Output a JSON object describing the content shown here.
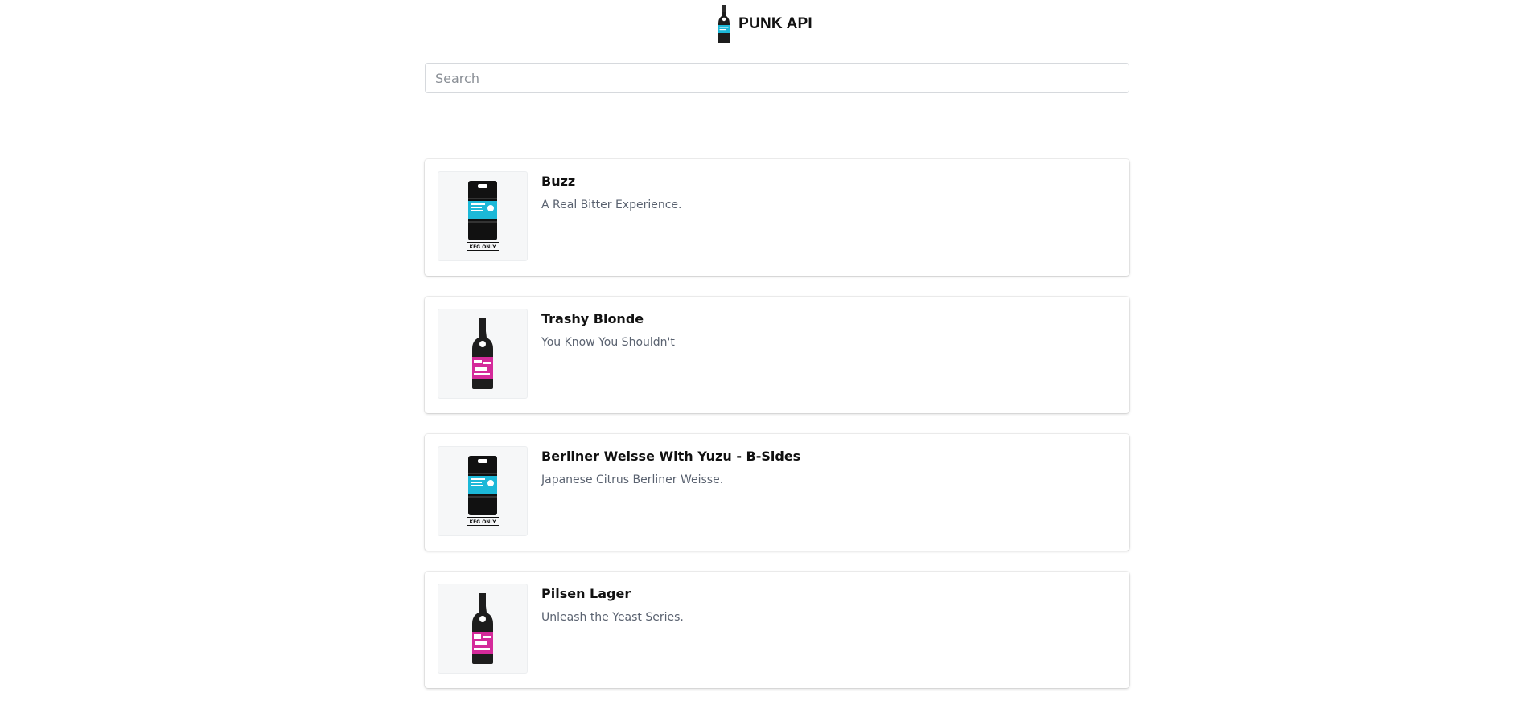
{
  "header": {
    "title": "PUNK API",
    "logo_icon": "beer-bottle-icon"
  },
  "search": {
    "placeholder": "Search",
    "value": ""
  },
  "beers": [
    {
      "name": "Buzz",
      "tagline": "A Real Bitter Experience.",
      "image_type": "keg",
      "label_color": "#1cb8d8",
      "keg_text": "KEG ONLY"
    },
    {
      "name": "Trashy Blonde",
      "tagline": "You Know You Shouldn't",
      "image_type": "bottle",
      "label_color": "#d42a9a"
    },
    {
      "name": "Berliner Weisse With Yuzu - B-Sides",
      "tagline": "Japanese Citrus Berliner Weisse.",
      "image_type": "keg",
      "label_color": "#1cb8d8",
      "keg_text": "KEG ONLY"
    },
    {
      "name": "Pilsen Lager",
      "tagline": "Unleash the Yeast Series.",
      "image_type": "bottle",
      "label_color": "#d42a9a"
    }
  ]
}
